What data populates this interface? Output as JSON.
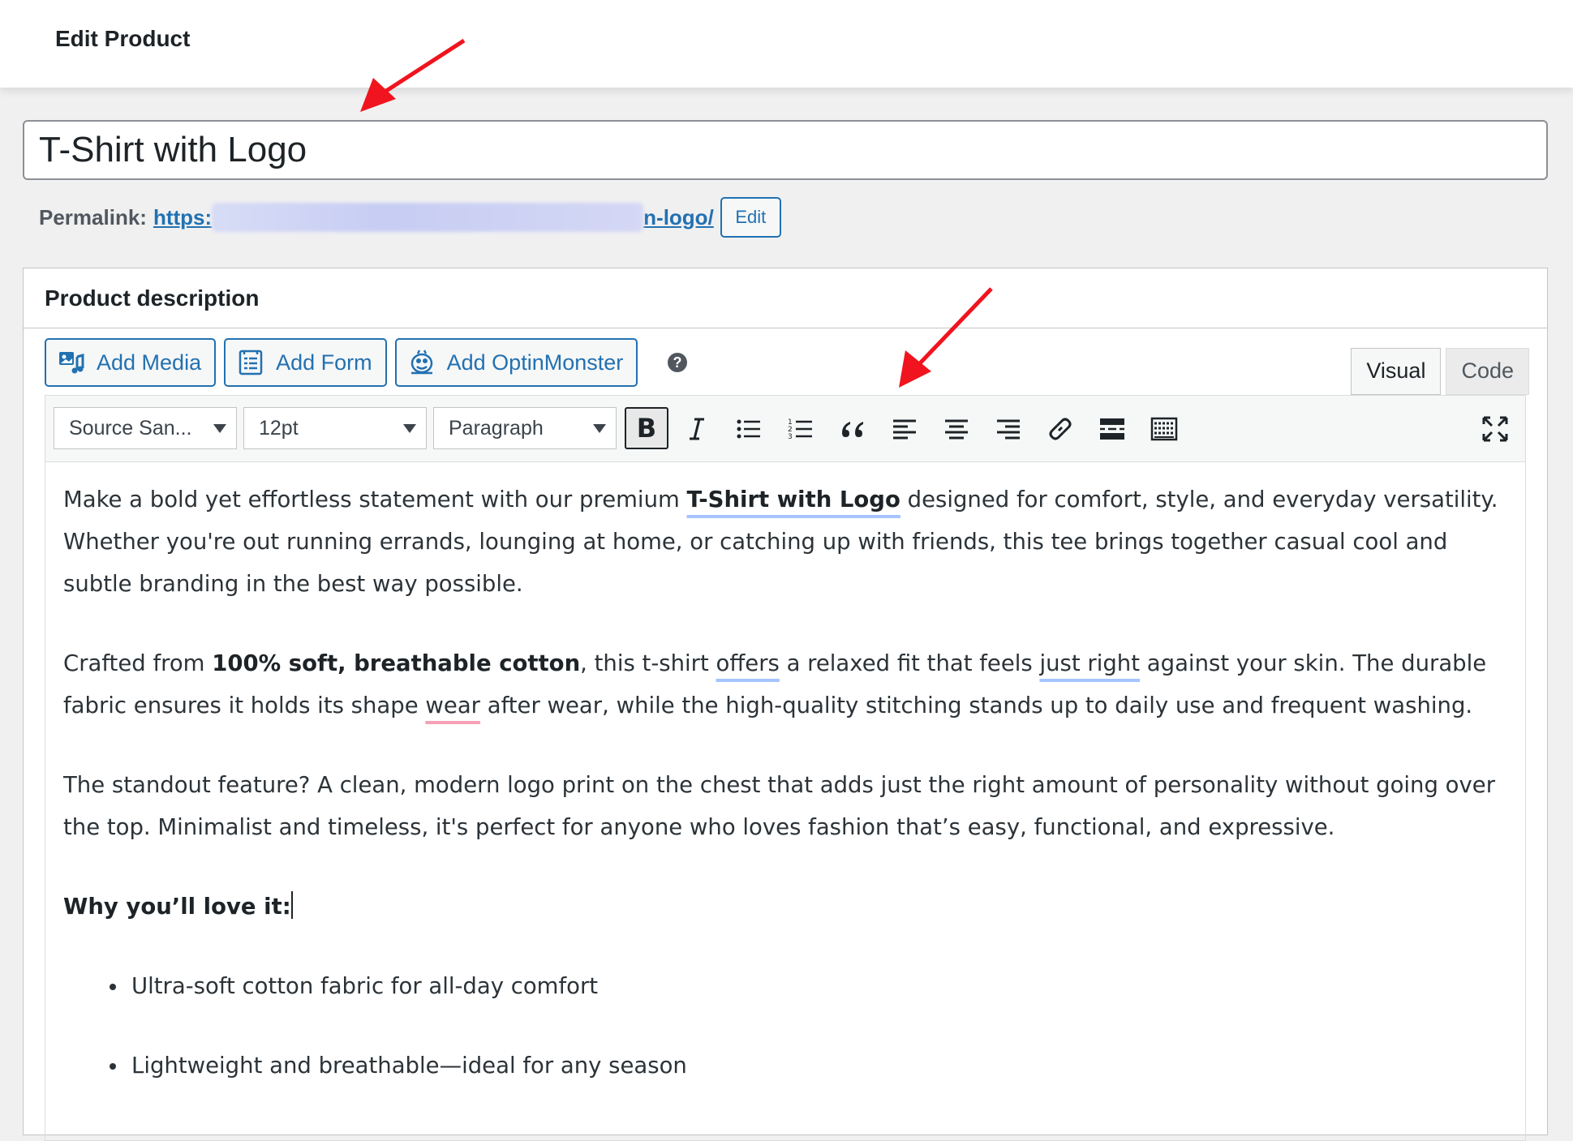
{
  "header": {
    "title": "Edit Product"
  },
  "product": {
    "title": "T-Shirt with Logo"
  },
  "permalink": {
    "label": "Permalink:",
    "url_start": "https:",
    "url_end": "n-logo/",
    "edit_label": "Edit"
  },
  "description": {
    "heading": "Product description",
    "media_buttons": {
      "add_media": "Add Media",
      "add_form": "Add Form",
      "add_optinmonster": "Add OptinMonster"
    },
    "help": "?",
    "tabs": {
      "visual": "Visual",
      "code": "Code"
    },
    "toolbar": {
      "font_family": "Source San...",
      "font_size": "12pt",
      "format": "Paragraph",
      "bold": "B"
    },
    "content": {
      "p1": {
        "before": "Make a bold yet effortless statement with our premium ",
        "bold": "T-Shirt with Logo",
        "after": " designed for comfort, style, and everyday versatility. Whether you're out running errands, lounging at home, or catching up with friends, this tee brings together casual cool and subtle branding in the best way possible."
      },
      "p2": {
        "t1": "Crafted from ",
        "bold": "100% soft, breathable cotton",
        "t2": ", this t-shirt ",
        "u1": "offers",
        "t3": " a relaxed fit that feels ",
        "u2": "just right",
        "t4": " against your skin. The durable fabric ensures it holds its shape ",
        "u3": "wear",
        "t5": " after wear, while the high-quality stitching stands up to daily use and frequent washing."
      },
      "p3": "The standout feature? A clean, modern logo print on the chest that adds just the right amount of personality without going over the top. Minimalist and timeless, it's perfect for anyone who loves fashion that’s easy, functional, and expressive.",
      "p4": "Why you’ll love it:",
      "bullets": [
        "Ultra-soft cotton fabric for all-day comfort",
        "Lightweight and breathable—ideal for any season"
      ]
    }
  },
  "colors": {
    "accent": "#2271b1",
    "arrow": "#f0141e"
  }
}
